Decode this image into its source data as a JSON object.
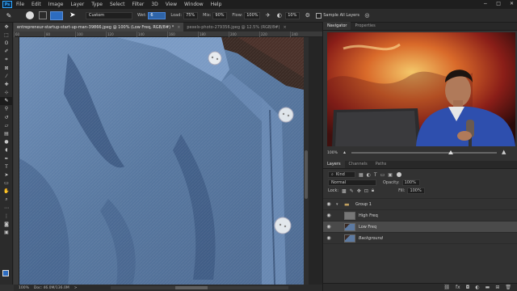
{
  "app": {
    "logo": "Ps"
  },
  "menu": [
    "File",
    "Edit",
    "Image",
    "Layer",
    "Type",
    "Select",
    "Filter",
    "3D",
    "View",
    "Window",
    "Help"
  ],
  "window_controls": [
    "−",
    "□",
    "✕"
  ],
  "options_bar": {
    "brush_preset": "Custom",
    "wet_label": "Wet:",
    "wet_value": "6",
    "load_label": "Load:",
    "load_value": "75%",
    "mix_label": "Mix:",
    "mix_value": "90%",
    "flow_label": "Flow:",
    "flow_value": "100%",
    "smoothing_value": "10%",
    "sample_all_layers": "Sample All Layers",
    "foreground_color": "#2d6cc0"
  },
  "documents": {
    "tabs": [
      {
        "label": "entrepreneur-startup-start-up-man-39866.jpeg @ 100% (Low Freq, RGB/8#) *",
        "close": "×",
        "active": true
      },
      {
        "label": "pexels-photo-279356.jpeg @ 12.5% (RGB/8#)",
        "close": "×",
        "active": false
      }
    ]
  },
  "ruler_ticks": [
    "60",
    "80",
    "100",
    "120",
    "140",
    "160",
    "180",
    "200",
    "220",
    "240"
  ],
  "status": {
    "zoom": "100%",
    "doc": "Doc: 46.0M/136.0M",
    "arrow": ">"
  },
  "panels": {
    "top_tabs": [
      "Navigator",
      "Properties"
    ],
    "nav_zoom": "100%",
    "layers_tabs": [
      "Layers",
      "Channels",
      "Paths"
    ],
    "kind_filter": "Kind",
    "blend_mode": "Normal",
    "opacity_label": "Opacity:",
    "opacity_value": "100%",
    "lock_label": "Lock:",
    "fill_label": "Fill:",
    "fill_value": "100%",
    "layers": [
      {
        "name": "Group 1",
        "type": "group"
      },
      {
        "name": "High Freq",
        "type": "gray"
      },
      {
        "name": "Low Freq",
        "type": "image",
        "selected": true
      },
      {
        "name": "Background",
        "type": "image",
        "italic": true
      }
    ]
  },
  "icons": {
    "tools": [
      "move-icon",
      "marquee-icon",
      "lasso-icon",
      "quick-select-icon",
      "crop-icon",
      "eyedropper-icon",
      "healing-icon",
      "brush-icon",
      "clone-stamp-icon",
      "history-brush-icon",
      "eraser-icon",
      "gradient-icon",
      "blur-icon",
      "dodge-icon",
      "pen-icon",
      "type-icon",
      "path-select-icon",
      "rectangle-icon",
      "hand-icon",
      "zoom-icon",
      "more-icon"
    ]
  }
}
